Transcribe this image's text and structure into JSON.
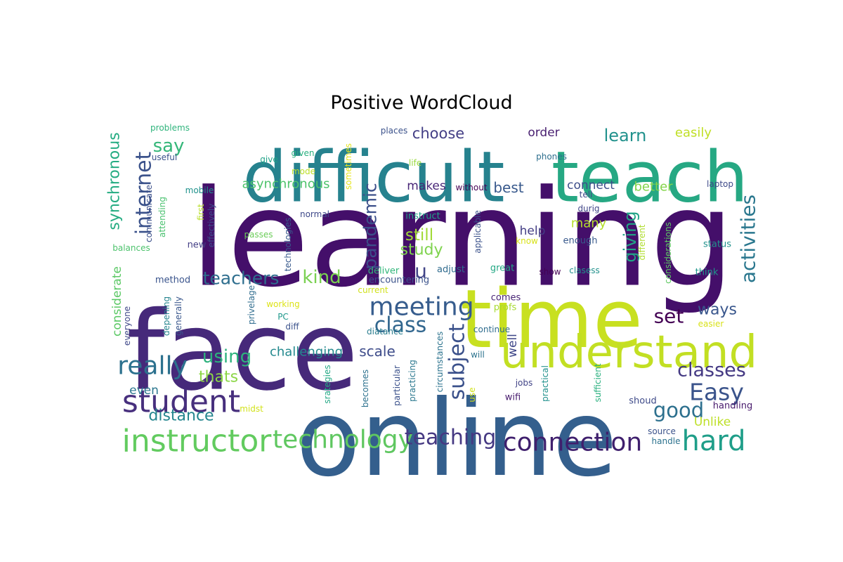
{
  "chart_data": {
    "type": "wordcloud",
    "title": "Positive WordCloud",
    "background": "#ffffff",
    "colormap": "viridis",
    "words": [
      {
        "text": "learning",
        "weight": 1.0,
        "color": "#440f6a",
        "orientation": "horizontal"
      },
      {
        "text": "face",
        "weight": 0.78,
        "color": "#46297a",
        "orientation": "horizontal"
      },
      {
        "text": "online",
        "weight": 0.75,
        "color": "#345f8d",
        "orientation": "horizontal"
      },
      {
        "text": "difficult",
        "weight": 0.55,
        "color": "#26828e",
        "orientation": "horizontal"
      },
      {
        "text": "teach",
        "weight": 0.5,
        "color": "#26a883",
        "orientation": "horizontal"
      },
      {
        "text": "time",
        "weight": 0.6,
        "color": "#c8e020",
        "orientation": "horizontal"
      },
      {
        "text": "understand",
        "weight": 0.37,
        "color": "#c2df23",
        "orientation": "horizontal"
      },
      {
        "text": "instructor",
        "weight": 0.26,
        "color": "#62cb5f",
        "orientation": "horizontal"
      },
      {
        "text": "student",
        "weight": 0.24,
        "color": "#472f7d",
        "orientation": "horizontal"
      },
      {
        "text": "connection",
        "weight": 0.22,
        "color": "#3f1f6d",
        "orientation": "horizontal"
      },
      {
        "text": "technology",
        "weight": 0.2,
        "color": "#5fc760",
        "orientation": "horizontal"
      },
      {
        "text": "hard",
        "weight": 0.23,
        "color": "#1f9e89",
        "orientation": "horizontal"
      },
      {
        "text": "meeting",
        "weight": 0.2,
        "color": "#365c8d",
        "orientation": "horizontal"
      },
      {
        "text": "really",
        "weight": 0.2,
        "color": "#2c718e",
        "orientation": "horizontal"
      },
      {
        "text": "teaching",
        "weight": 0.17,
        "color": "#453882",
        "orientation": "horizontal"
      },
      {
        "text": "class",
        "weight": 0.17,
        "color": "#31668e",
        "orientation": "horizontal"
      },
      {
        "text": "Easy",
        "weight": 0.18,
        "color": "#3a538b",
        "orientation": "horizontal"
      },
      {
        "text": "classes",
        "weight": 0.14,
        "color": "#443983",
        "orientation": "horizontal"
      },
      {
        "text": "good",
        "weight": 0.15,
        "color": "#2d708e",
        "orientation": "horizontal"
      },
      {
        "text": "set",
        "weight": 0.14,
        "color": "#440154",
        "orientation": "horizontal"
      },
      {
        "text": "teachers",
        "weight": 0.13,
        "color": "#2e6e8e",
        "orientation": "horizontal"
      },
      {
        "text": "kind",
        "weight": 0.14,
        "color": "#7ad151",
        "orientation": "horizontal"
      },
      {
        "text": "using",
        "weight": 0.14,
        "color": "#2db27d",
        "orientation": "horizontal"
      },
      {
        "text": "u",
        "weight": 0.14,
        "color": "#414487",
        "orientation": "horizontal"
      },
      {
        "text": "internet",
        "weight": 0.15,
        "color": "#3b528b",
        "orientation": "vertical"
      },
      {
        "text": "pandemic",
        "weight": 0.13,
        "color": "#3c4f8a",
        "orientation": "vertical"
      },
      {
        "text": "subject",
        "weight": 0.16,
        "color": "#3b518b",
        "orientation": "vertical"
      },
      {
        "text": "activities",
        "weight": 0.15,
        "color": "#2a778e",
        "orientation": "vertical"
      },
      {
        "text": "giving",
        "weight": 0.12,
        "color": "#20a386",
        "orientation": "vertical"
      },
      {
        "text": "synchronous",
        "weight": 0.1,
        "color": "#25ac82",
        "orientation": "vertical"
      },
      {
        "text": "say",
        "weight": 0.12,
        "color": "#35b779",
        "orientation": "horizontal"
      },
      {
        "text": "learn",
        "weight": 0.11,
        "color": "#21918c",
        "orientation": "horizontal"
      },
      {
        "text": "choose",
        "weight": 0.1,
        "color": "#433e85",
        "orientation": "horizontal"
      },
      {
        "text": "still",
        "weight": 0.11,
        "color": "#a2da37",
        "orientation": "horizontal"
      },
      {
        "text": "study",
        "weight": 0.1,
        "color": "#7fd34e",
        "orientation": "horizontal"
      },
      {
        "text": "ways",
        "weight": 0.1,
        "color": "#39568c",
        "orientation": "horizontal"
      },
      {
        "text": "scale",
        "weight": 0.09,
        "color": "#3e4c8a",
        "orientation": "horizontal"
      },
      {
        "text": "challenging",
        "weight": 0.09,
        "color": "#23898e",
        "orientation": "horizontal"
      },
      {
        "text": "thats",
        "weight": 0.09,
        "color": "#8bd646",
        "orientation": "horizontal"
      },
      {
        "text": "distance",
        "weight": 0.09,
        "color": "#24868e",
        "orientation": "horizontal"
      },
      {
        "text": "asynchronous",
        "weight": 0.08,
        "color": "#4ec36b",
        "orientation": "horizontal"
      },
      {
        "text": "makes",
        "weight": 0.08,
        "color": "#482677",
        "orientation": "horizontal"
      },
      {
        "text": "best",
        "weight": 0.08,
        "color": "#38598c",
        "orientation": "horizontal"
      },
      {
        "text": "connect",
        "weight": 0.08,
        "color": "#3d4e8a",
        "orientation": "horizontal"
      },
      {
        "text": "better",
        "weight": 0.08,
        "color": "#84d44b",
        "orientation": "horizontal"
      },
      {
        "text": "easily",
        "weight": 0.08,
        "color": "#c0df25",
        "orientation": "horizontal"
      },
      {
        "text": "order",
        "weight": 0.08,
        "color": "#481f70",
        "orientation": "horizontal"
      },
      {
        "text": "many",
        "weight": 0.08,
        "color": "#b5de2b",
        "orientation": "horizontal"
      },
      {
        "text": "help",
        "weight": 0.07,
        "color": "#433d84",
        "orientation": "horizontal"
      },
      {
        "text": "Unlike",
        "weight": 0.07,
        "color": "#bddf26",
        "orientation": "horizontal"
      },
      {
        "text": "even",
        "weight": 0.07,
        "color": "#2a768e",
        "orientation": "horizontal"
      },
      {
        "text": "considerate",
        "weight": 0.07,
        "color": "#5ac864",
        "orientation": "vertical"
      },
      {
        "text": "well",
        "weight": 0.07,
        "color": "#3f4788",
        "orientation": "vertical"
      },
      {
        "text": "encountering",
        "weight": 0.06,
        "color": "#3b528b",
        "orientation": "horizontal"
      },
      {
        "text": "handling",
        "weight": 0.06,
        "color": "#481a6c",
        "orientation": "horizontal"
      },
      {
        "text": "great",
        "weight": 0.06,
        "color": "#22a884",
        "orientation": "horizontal"
      },
      {
        "text": "show",
        "weight": 0.05,
        "color": "#440154",
        "orientation": "horizontal"
      },
      {
        "text": "clasess",
        "weight": 0.05,
        "color": "#21918c",
        "orientation": "horizontal"
      },
      {
        "text": "adjust",
        "weight": 0.05,
        "color": "#2f6b8e",
        "orientation": "horizontal"
      },
      {
        "text": "deliver",
        "weight": 0.05,
        "color": "#32b67a",
        "orientation": "horizontal"
      },
      {
        "text": "current",
        "weight": 0.05,
        "color": "#d0e11c",
        "orientation": "horizontal"
      },
      {
        "text": "comes",
        "weight": 0.05,
        "color": "#482475",
        "orientation": "horizontal"
      },
      {
        "text": "profs",
        "weight": 0.05,
        "color": "#a8db34",
        "orientation": "horizontal"
      },
      {
        "text": "continue",
        "weight": 0.05,
        "color": "#2f6c8e",
        "orientation": "horizontal"
      },
      {
        "text": "diatance",
        "weight": 0.05,
        "color": "#287c8e",
        "orientation": "horizontal"
      },
      {
        "text": "will",
        "weight": 0.05,
        "color": "#2c738e",
        "orientation": "horizontal"
      },
      {
        "text": "jobs",
        "weight": 0.05,
        "color": "#414487",
        "orientation": "horizontal"
      },
      {
        "text": "wifi",
        "weight": 0.05,
        "color": "#481c6e",
        "orientation": "horizontal"
      },
      {
        "text": "shoud",
        "weight": 0.05,
        "color": "#3e4a89",
        "orientation": "horizontal"
      },
      {
        "text": "source",
        "weight": 0.05,
        "color": "#3b528b",
        "orientation": "horizontal"
      },
      {
        "text": "handle",
        "weight": 0.05,
        "color": "#2c728e",
        "orientation": "horizontal"
      },
      {
        "text": "working",
        "weight": 0.05,
        "color": "#dde318",
        "orientation": "horizontal"
      },
      {
        "text": "PC",
        "weight": 0.05,
        "color": "#1f988b",
        "orientation": "horizontal"
      },
      {
        "text": "diff",
        "weight": 0.05,
        "color": "#3b528b",
        "orientation": "horizontal"
      },
      {
        "text": "midst",
        "weight": 0.05,
        "color": "#d2e21b",
        "orientation": "horizontal"
      },
      {
        "text": "method",
        "weight": 0.05,
        "color": "#3a548c",
        "orientation": "horizontal"
      },
      {
        "text": "new",
        "weight": 0.05,
        "color": "#433e85",
        "orientation": "horizontal"
      },
      {
        "text": "passes",
        "weight": 0.05,
        "color": "#6ccd5a",
        "orientation": "horizontal"
      },
      {
        "text": "normal",
        "weight": 0.05,
        "color": "#3e4989",
        "orientation": "horizontal"
      },
      {
        "text": "instruct",
        "weight": 0.05,
        "color": "#1fa088",
        "orientation": "horizontal"
      },
      {
        "text": "without",
        "weight": 0.05,
        "color": "#440154",
        "orientation": "horizontal"
      },
      {
        "text": "tell",
        "weight": 0.05,
        "color": "#3f4889",
        "orientation": "horizontal"
      },
      {
        "text": "durig",
        "weight": 0.05,
        "color": "#404588",
        "orientation": "horizontal"
      },
      {
        "text": "enough",
        "weight": 0.05,
        "color": "#38598c",
        "orientation": "horizontal"
      },
      {
        "text": "know",
        "weight": 0.05,
        "color": "#d8e219",
        "orientation": "horizontal"
      },
      {
        "text": "laptop",
        "weight": 0.05,
        "color": "#3e4a89",
        "orientation": "horizontal"
      },
      {
        "text": "status",
        "weight": 0.05,
        "color": "#21918c",
        "orientation": "horizontal"
      },
      {
        "text": "think",
        "weight": 0.05,
        "color": "#1f968b",
        "orientation": "horizontal"
      },
      {
        "text": "easier",
        "weight": 0.05,
        "color": "#d8e219",
        "orientation": "horizontal"
      },
      {
        "text": "phones",
        "weight": 0.05,
        "color": "#2e6f8e",
        "orientation": "horizontal"
      },
      {
        "text": "places",
        "weight": 0.05,
        "color": "#3b528b",
        "orientation": "horizontal"
      },
      {
        "text": "life",
        "weight": 0.05,
        "color": "#98d83e",
        "orientation": "horizontal"
      },
      {
        "text": "give",
        "weight": 0.05,
        "color": "#1fa287",
        "orientation": "horizontal"
      },
      {
        "text": "given",
        "weight": 0.05,
        "color": "#2ab07f",
        "orientation": "horizontal"
      },
      {
        "text": "mode",
        "weight": 0.05,
        "color": "#bddf26",
        "orientation": "horizontal"
      },
      {
        "text": "useful",
        "weight": 0.05,
        "color": "#3b528b",
        "orientation": "horizontal"
      },
      {
        "text": "problems",
        "weight": 0.05,
        "color": "#2fb47c",
        "orientation": "horizontal"
      },
      {
        "text": "mobile",
        "weight": 0.05,
        "color": "#20928c",
        "orientation": "horizontal"
      },
      {
        "text": "balances",
        "weight": 0.05,
        "color": "#4cc26c",
        "orientation": "horizontal"
      },
      {
        "text": "everyone",
        "weight": 0.05,
        "color": "#3f4788",
        "orientation": "vertical"
      },
      {
        "text": "generally",
        "weight": 0.05,
        "color": "#39568c",
        "orientation": "vertical"
      },
      {
        "text": "depening",
        "weight": 0.05,
        "color": "#25848e",
        "orientation": "vertical"
      },
      {
        "text": "privelage",
        "weight": 0.05,
        "color": "#2f6c8e",
        "orientation": "vertical"
      },
      {
        "text": "technologies",
        "weight": 0.05,
        "color": "#38598c",
        "orientation": "vertical"
      },
      {
        "text": "first",
        "weight": 0.05,
        "color": "#b8de29",
        "orientation": "vertical"
      },
      {
        "text": "effectively",
        "weight": 0.05,
        "color": "#3e4c8a",
        "orientation": "vertical"
      },
      {
        "text": "communicate",
        "weight": 0.05,
        "color": "#3c508b",
        "orientation": "vertical"
      },
      {
        "text": "attending",
        "weight": 0.05,
        "color": "#48c16e",
        "orientation": "vertical"
      },
      {
        "text": "sometimes",
        "weight": 0.05,
        "color": "#e5e419",
        "orientation": "vertical"
      },
      {
        "text": "applicable",
        "weight": 0.05,
        "color": "#3b528b",
        "orientation": "vertical"
      },
      {
        "text": "different",
        "weight": 0.05,
        "color": "#b0dd2f",
        "orientation": "vertical"
      },
      {
        "text": "considerations",
        "weight": 0.05,
        "color": "#5ec962",
        "orientation": "vertical"
      },
      {
        "text": "srategies",
        "weight": 0.05,
        "color": "#22a884",
        "orientation": "vertical"
      },
      {
        "text": "becomes",
        "weight": 0.05,
        "color": "#2c718e",
        "orientation": "vertical"
      },
      {
        "text": "particular",
        "weight": 0.05,
        "color": "#3b518b",
        "orientation": "vertical"
      },
      {
        "text": "practicing",
        "weight": 0.05,
        "color": "#2a778e",
        "orientation": "vertical"
      },
      {
        "text": "circumstances",
        "weight": 0.05,
        "color": "#2c738e",
        "orientation": "vertical"
      },
      {
        "text": "use",
        "weight": 0.05,
        "color": "#d0e11c",
        "orientation": "vertical"
      },
      {
        "text": "practical",
        "weight": 0.05,
        "color": "#21918c",
        "orientation": "vertical"
      },
      {
        "text": "sufficient",
        "weight": 0.05,
        "color": "#2ab07f",
        "orientation": "vertical"
      }
    ]
  }
}
